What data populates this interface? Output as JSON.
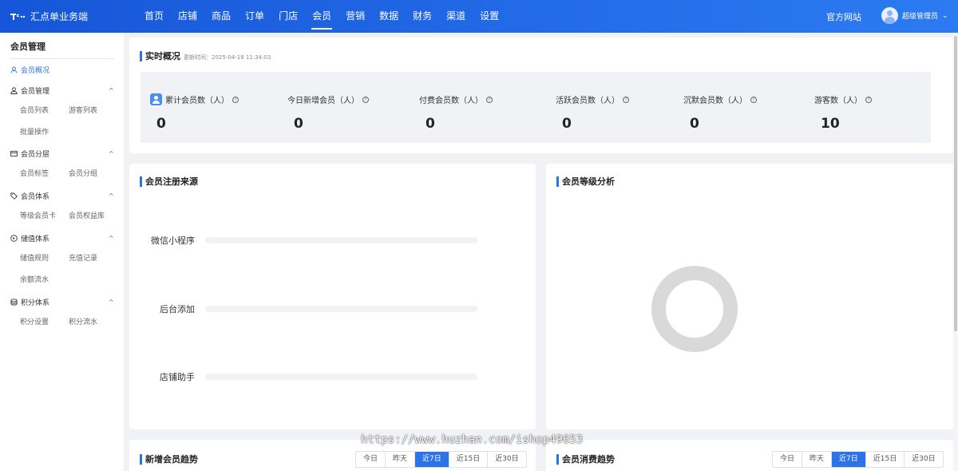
{
  "app": {
    "name": "汇点单业务端"
  },
  "nav": {
    "items": [
      "首页",
      "店铺",
      "商品",
      "订单",
      "门店",
      "会员",
      "营销",
      "数据",
      "财务",
      "渠道",
      "设置"
    ],
    "active_index": 5
  },
  "header": {
    "official_site": "官方网站",
    "user_name": "超级管理员"
  },
  "sidebar": {
    "title": "会员管理",
    "overview": "会员概况",
    "groups": [
      {
        "label": "会员管理",
        "icon": "user-icon",
        "items": [
          "会员列表",
          "游客列表",
          "批量操作"
        ]
      },
      {
        "label": "会员分层",
        "icon": "layers-icon",
        "items": [
          "会员标签",
          "会员分组"
        ]
      },
      {
        "label": "会员体系",
        "icon": "tag-icon",
        "items": [
          "等级会员卡",
          "会员权益库"
        ]
      },
      {
        "label": "储值体系",
        "icon": "wallet-icon",
        "items": [
          "储值规则",
          "充值记录",
          "余额流水"
        ]
      },
      {
        "label": "积分体系",
        "icon": "coins-icon",
        "items": [
          "积分设置",
          "积分流水"
        ]
      }
    ]
  },
  "realtime": {
    "title": "实时概况",
    "update_time": "更新时间：2025-04-18 11:34:03",
    "stats": [
      {
        "label": "累计会员数（人）",
        "value": "0"
      },
      {
        "label": "今日新增会员（人）",
        "value": "0"
      },
      {
        "label": "付费会员数（人）",
        "value": "0"
      },
      {
        "label": "活跃会员数（人）",
        "value": "0"
      },
      {
        "label": "沉默会员数（人）",
        "value": "0"
      },
      {
        "label": "游客数（人）",
        "value": "10"
      }
    ]
  },
  "register_source": {
    "title": "会员注册来源",
    "sources": [
      {
        "label": "微信小程序",
        "value": 0
      },
      {
        "label": "后台添加",
        "value": 0
      },
      {
        "label": "店铺助手",
        "value": 0
      }
    ]
  },
  "level_analysis": {
    "title": "会员等级分析",
    "ring_color": "#d9d9d9"
  },
  "new_member_trend": {
    "title": "新增会员趋势"
  },
  "consumption_trend": {
    "title": "会员消费趋势"
  },
  "range_tabs": {
    "items": [
      "今日",
      "昨天",
      "近7日",
      "近15日",
      "近30日"
    ],
    "active_index": 2
  },
  "watermark": "https://www.huzhan.com/ishop49653",
  "colors": {
    "primary": "#2d73e8",
    "topbar": "#1656d8"
  }
}
